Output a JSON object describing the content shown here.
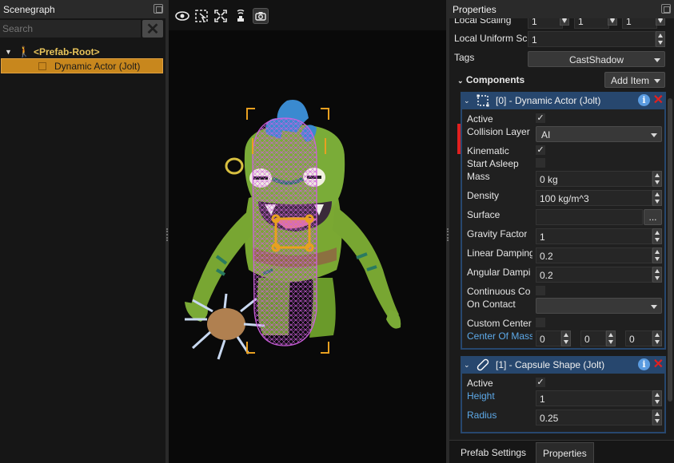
{
  "scenegraph": {
    "title": "Scenegraph",
    "search_placeholder": "Search",
    "clear_icon": "close-icon",
    "tree": [
      {
        "label": "<Prefab-Root>",
        "icon": "prefab-icon",
        "expanded": true
      },
      {
        "label": "Dynamic Actor (Jolt)",
        "icon": "object-icon",
        "selected": true
      }
    ]
  },
  "viewport": {
    "toolbar": [
      "eye-icon",
      "select-icon",
      "fullscreen-icon",
      "render-icon",
      "camera-icon"
    ],
    "colors": {
      "selection": "#e8a020",
      "collider": "#d060e0",
      "background": "#090909"
    }
  },
  "properties": {
    "title": "Properties",
    "local_scaling_label": "Local Scaling",
    "local_scaling_values": [
      "1",
      "1",
      "1"
    ],
    "local_uniform_scale_label": "Local Uniform Sc",
    "local_uniform_scale_value": "1",
    "tags_label": "Tags",
    "tags_value": "CastShadow",
    "components_label": "Components",
    "add_item_label": "Add Item",
    "dynamic_actor": {
      "title": "[0] - Dynamic Actor (Jolt)",
      "active_label": "Active",
      "active": "✓",
      "collision_layer_label": "Collision Layer",
      "collision_layer_value": "AI",
      "kinematic_label": "Kinematic",
      "kinematic": "✓",
      "start_asleep_label": "Start Asleep",
      "mass_label": "Mass",
      "mass_value": "0 kg",
      "density_label": "Density",
      "density_value": "100 kg/m^3",
      "surface_label": "Surface",
      "surface_value": "",
      "surface_button": "...",
      "gravity_factor_label": "Gravity Factor",
      "gravity_factor_value": "1",
      "linear_damping_label": "Linear Damping",
      "linear_damping_value": "0.2",
      "angular_damping_label": "Angular Dampi",
      "angular_damping_value": "0.2",
      "continuous_label": "Continuous Co",
      "on_contact_label": "On Contact",
      "on_contact_value": "",
      "custom_center_label": "Custom Center",
      "center_of_mass_label": "Center Of Mass",
      "center_of_mass_values": [
        "0",
        "0",
        "0"
      ]
    },
    "capsule_shape": {
      "title": "[1] - Capsule Shape (Jolt)",
      "active_label": "Active",
      "active": "✓",
      "height_label": "Height",
      "height_value": "1",
      "radius_label": "Radius",
      "radius_value": "0.25"
    },
    "tabs": [
      "Prefab Settings",
      "Properties"
    ],
    "active_tab": "Properties"
  }
}
